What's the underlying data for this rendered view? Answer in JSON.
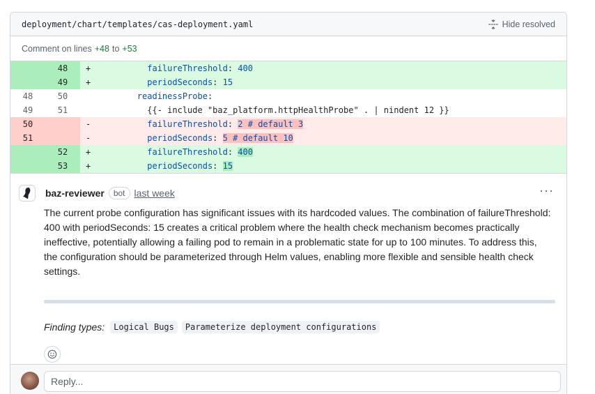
{
  "file": {
    "path": "deployment/chart/templates/cas-deployment.yaml",
    "hide_resolved_label": "Hide resolved"
  },
  "caption": {
    "prefix": "Comment on lines",
    "from": "+48",
    "middle": "to",
    "to": "+53"
  },
  "diff": [
    {
      "type": "add",
      "old": "",
      "new": "48",
      "sign": "+",
      "key": "failureThreshold",
      "sep": ": ",
      "val": "400",
      "indent": "          "
    },
    {
      "type": "add",
      "old": "",
      "new": "49",
      "sign": "+",
      "key": "periodSeconds",
      "sep": ": ",
      "val": "15",
      "indent": "          "
    },
    {
      "type": "ctx",
      "old": "48",
      "new": "50",
      "sign": "",
      "key": "readinessProbe",
      "sep": ":",
      "val": "",
      "indent": "        "
    },
    {
      "type": "ctx",
      "old": "49",
      "new": "51",
      "sign": "",
      "key": "",
      "sep": "",
      "val": "{{- include \"baz_platform.httpHealthProbe\" . | nindent 12 }}",
      "indent": "          "
    },
    {
      "type": "del",
      "old": "50",
      "new": "",
      "sign": "-",
      "key": "failureThreshold",
      "sep": ": ",
      "val": "2 # default 3",
      "indent": "          "
    },
    {
      "type": "del",
      "old": "51",
      "new": "",
      "sign": "-",
      "key": "periodSeconds",
      "sep": ": ",
      "val": "5 # default 10",
      "indent": "          "
    },
    {
      "type": "add",
      "old": "",
      "new": "52",
      "sign": "+",
      "key": "failureThreshold",
      "sep": ": ",
      "val": "400",
      "indent": "          "
    },
    {
      "type": "add",
      "old": "",
      "new": "53",
      "sign": "+",
      "key": "periodSeconds",
      "sep": ": ",
      "val": "15",
      "indent": "          "
    }
  ],
  "comment": {
    "author": "baz-reviewer",
    "badge": "bot",
    "time": "last week",
    "more": "···",
    "body": "The current probe configuration has significant issues with its hardcoded values. The combination of failureThreshold: 400 with periodSeconds: 15 creates a critical problem where the health check mechanism becomes practically ineffective, potentially allowing a failing pod to remain in a problematic state for up to 100 minutes. To address this, the configuration should be parameterized through Helm values, enabling more flexible and sensible health check settings.",
    "finding_label": "Finding types:",
    "tags": [
      "Logical Bugs",
      "Parameterize deployment configurations"
    ]
  },
  "reply": {
    "placeholder": "Reply..."
  },
  "colors": {
    "add_bg": "#dafbe1",
    "add_num_bg": "#aceebb",
    "del_bg": "#ffebe9",
    "del_num_bg": "#ffcecb",
    "key_blue": "#0550ae"
  }
}
